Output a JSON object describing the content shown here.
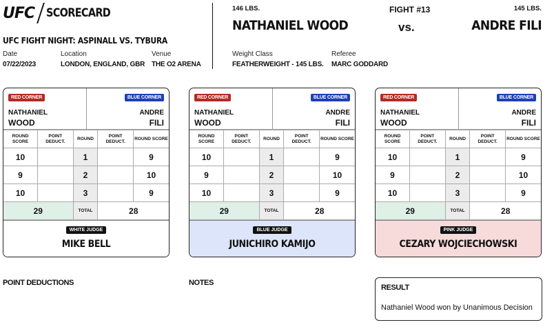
{
  "header": {
    "brand": "UFC",
    "title": "SCORECARD",
    "event": "UFC FIGHT NIGHT: ASPINALL VS. TYBURA",
    "date_label": "Date",
    "date": "07/22/2023",
    "location_label": "Location",
    "location": "LONDON, ENGLAND, GBR",
    "venue_label": "Venue",
    "venue": "THE O2 ARENA"
  },
  "fight": {
    "number": "FIGHT #13",
    "red_weight": "146 LBS.",
    "blue_weight": "145 LBS.",
    "red_name": "NATHANIEL WOOD",
    "blue_name": "ANDRE FILI",
    "vs": "vs.",
    "weight_class_label": "Weight Class",
    "weight_class": "FEATHERWEIGHT - 145 LBS.",
    "referee_label": "Referee",
    "referee": "MARC GODDARD"
  },
  "table_labels": {
    "red_corner": "RED CORNER",
    "blue_corner": "BLUE CORNER",
    "red_first": "NATHANIEL",
    "red_last": "WOOD",
    "blue_first": "ANDRE",
    "blue_last": "FILI",
    "round_score": "ROUND SCORE",
    "point_deduct": "POINT DEDUCT.",
    "round": "ROUND",
    "total": "TOTAL"
  },
  "cards": [
    {
      "judge_badge": "WHITE JUDGE",
      "judge_name": "MIKE BELL",
      "rounds": [
        {
          "red": "10",
          "red_ded": "",
          "round": "1",
          "blue_ded": "",
          "blue": "9"
        },
        {
          "red": "9",
          "red_ded": "",
          "round": "2",
          "blue_ded": "",
          "blue": "10"
        },
        {
          "red": "10",
          "red_ded": "",
          "round": "3",
          "blue_ded": "",
          "blue": "9"
        }
      ],
      "red_total": "29",
      "blue_total": "28"
    },
    {
      "judge_badge": "BLUE JUDGE",
      "judge_name": "JUNICHIRO KAMIJO",
      "rounds": [
        {
          "red": "10",
          "red_ded": "",
          "round": "1",
          "blue_ded": "",
          "blue": "9"
        },
        {
          "red": "9",
          "red_ded": "",
          "round": "2",
          "blue_ded": "",
          "blue": "10"
        },
        {
          "red": "10",
          "red_ded": "",
          "round": "3",
          "blue_ded": "",
          "blue": "9"
        }
      ],
      "red_total": "29",
      "blue_total": "28"
    },
    {
      "judge_badge": "PINK JUDGE",
      "judge_name": "CEZARY WOJCIECHOWSKI",
      "rounds": [
        {
          "red": "10",
          "red_ded": "",
          "round": "1",
          "blue_ded": "",
          "blue": "9"
        },
        {
          "red": "9",
          "red_ded": "",
          "round": "2",
          "blue_ded": "",
          "blue": "10"
        },
        {
          "red": "10",
          "red_ded": "",
          "round": "3",
          "blue_ded": "",
          "blue": "9"
        }
      ],
      "red_total": "29",
      "blue_total": "28"
    }
  ],
  "sections": {
    "point_deductions": "POINT DEDUCTIONS",
    "notes": "NOTES",
    "result_title": "RESULT",
    "result_text": "Nathaniel Wood won by Unanimous Decision"
  },
  "colors": {
    "red_corner": "#b32a25",
    "blue_corner": "#1f3fb5",
    "white_judge_bg": "#ffffff",
    "blue_judge_bg": "#dde5fb",
    "pink_judge_bg": "#f7dada",
    "red_total_bg": "#dff0e6"
  }
}
